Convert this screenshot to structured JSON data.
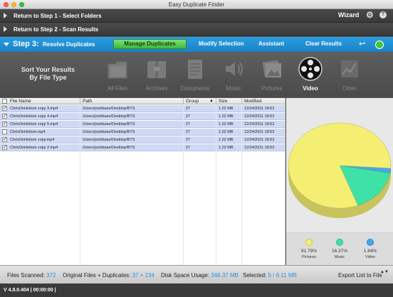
{
  "window": {
    "title": "Easy Duplicate Finder"
  },
  "steps": {
    "step1_label": "Return to Step 1 - Select Folders",
    "step2_label": "Return to Step 2 - Scan Results",
    "wizard_label": "Wizard",
    "help_glyph": "?",
    "gear_glyph": "⚙"
  },
  "step3": {
    "number": "Step 3:",
    "subtitle": "Resolve Duplicates",
    "tabs": {
      "manage": "Manage Duplicates",
      "modify": "Modify Selection",
      "assistant": "Assistant",
      "clear": "Clear Results"
    },
    "undo_glyph": "↩"
  },
  "sort": {
    "title_line1": "Sort Your Results",
    "title_line2": "By File Type",
    "types": [
      {
        "label": "All Files",
        "icon": "all-files-icon"
      },
      {
        "label": "Archives",
        "icon": "archives-icon"
      },
      {
        "label": "Documents",
        "icon": "documents-icon"
      },
      {
        "label": "Music",
        "icon": "music-icon"
      },
      {
        "label": "Pictures",
        "icon": "pictures-icon"
      },
      {
        "label": "Video",
        "icon": "video-icon",
        "selected": true
      },
      {
        "label": "Other",
        "icon": "other-icon"
      }
    ]
  },
  "table": {
    "headers": {
      "file": "File Name",
      "path": "Path",
      "group": "Group",
      "size": "Size",
      "modified": "Modified",
      "sort_glyph": "▲"
    },
    "check_glyph": "✓",
    "rows": [
      {
        "checked": true,
        "file": "ChrisOnHelium copy 3.mp4",
        "path": "/Users/joshbase/Desktop/BTS",
        "group": "27",
        "size": "1.22 MB",
        "modified": "12/24/2011 18:52"
      },
      {
        "checked": true,
        "file": "ChrisOnHelium copy 4.mp4",
        "path": "/Users/joshbase/Desktop/BTS",
        "group": "27",
        "size": "1.22 MB",
        "modified": "12/24/2011 18:52"
      },
      {
        "checked": true,
        "file": "ChrisOnHelium copy 5.mp4",
        "path": "/Users/joshbase/Desktop/BTS",
        "group": "27",
        "size": "1.22 MB",
        "modified": "12/24/2011 18:52"
      },
      {
        "checked": false,
        "file": "ChrisOnHelium.mp4",
        "path": "/Users/joshbase/Desktop/BTS",
        "group": "27",
        "size": "1.22 MB",
        "modified": "12/24/2011 18:52"
      },
      {
        "checked": true,
        "file": "ChrisOnHelium copy.mp4",
        "path": "/Users/joshbase/Desktop/BTS",
        "group": "27",
        "size": "1.22 MB",
        "modified": "12/24/2011 18:52"
      },
      {
        "checked": true,
        "file": "ChrisOnHelium copy 2.mp4",
        "path": "/Users/joshbase/Desktop/BTS",
        "group": "27",
        "size": "1.22 MB",
        "modified": "12/24/2011 18:52"
      }
    ]
  },
  "pie": {
    "slices": [
      {
        "name": "Pictures",
        "value": 81.79,
        "label": "81.79%",
        "color": "#f4ef72"
      },
      {
        "name": "Music",
        "value": 16.37,
        "label": "16.37%",
        "color": "#3fe2a6"
      },
      {
        "name": "Video",
        "value": 1.84,
        "label": "1.84%",
        "color": "#4aa6e6"
      }
    ]
  },
  "bottom": {
    "files_scanned_label": "Files Scanned:",
    "files_scanned_value": "372",
    "originals_label": "Original Files + Duplicates:",
    "originals_value": "37 + 234",
    "disk_label": "Disk Space Usage:",
    "disk_value": "346.37 MB",
    "selected_label": "Selected:",
    "selected_value": "5 / 6.11 MB",
    "export_label": "Export List to File",
    "export_arrows": "▲▼"
  },
  "status": {
    "text": "V 4.8.0.404 | 00:00:00 |"
  },
  "colors": {
    "accent": "#2a9de0",
    "active_tab": "#3fb83a",
    "row_highlight": "#cfd9f4"
  }
}
